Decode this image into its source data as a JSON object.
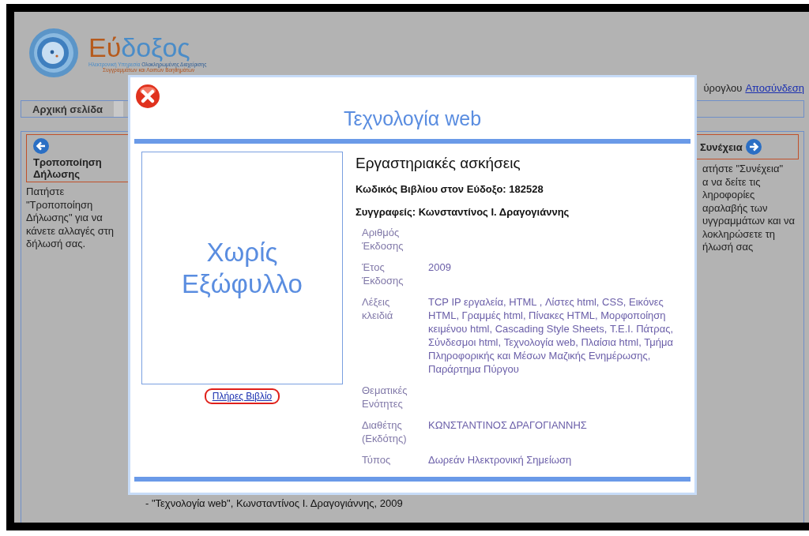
{
  "logo": {
    "title_first": "Εύ",
    "title_rest": "δοξος",
    "subtitle_first": "Ηλεκτρονική Υπηρεσία",
    "subtitle_rest": "Ολοκληρωμένης Διαχείρισης",
    "subtitle_line2": "Συγγραμμάτων και Λοιπών Βοηθημάτων"
  },
  "user_bar": {
    "name": "ύρογλου",
    "logout": "Αποσύνδεση"
  },
  "nav": {
    "tabs": [
      {
        "label": "Αρχική σελίδα",
        "selected": true
      }
    ]
  },
  "left_panel": {
    "button": "Τροποποίηση Δήλωσης",
    "text": "Πατήστε \"Τροποποίηση Δήλωσης\" για να κάνετε αλλαγές στη δήλωσή σας."
  },
  "right_panel": {
    "button": "Συνέχεια",
    "text_lines": [
      "ατήστε \"Συνέχεια\"",
      "α να δείτε τις",
      "ληροφορίες",
      "αραλαβής των",
      "υγγραμμάτων και να",
      "λοκληρώσετε τη",
      "ήλωσή σας"
    ]
  },
  "book_list": [
    "- \"Τεχνολογία web\", Κωνσταντίνος Ι. Δραγογιάννης, 2009"
  ],
  "dialog": {
    "title": "Τεχνολογία web",
    "cover_text": "Χωρίς Εξώφυλλο",
    "full_book_link": "Πλήρες Βιβλίο",
    "subtitle": "Εργαστηριακές ασκήσεις",
    "code_line": "Κωδικός Βιβλίου στον Εύδοξο: 182528",
    "authors_line": "Συγγραφείς: Κωνσταντίνος Ι. Δραγογιάννης",
    "details": [
      {
        "label": "Αριθμός Έκδοσης"
      },
      {
        "label": "Έτος Έκδοσης",
        "value": "2009"
      },
      {
        "label": "Λέξεις κλειδιά",
        "value": "TCP IP εργαλεία, HTML , Λίστες html, CSS, Εικόνες HTML, Γραμμές html, Πίνακες HTML, Μορφοποίηση κειμένου html, Cascading Style Sheets, Τ.Ε.Ι. Πάτρας, Σύνδεσμοι html, Τεχνολογία web, Πλαίσια html, Τμήμα Πληροφορικής και Μέσων Μαζικής Ενημέρωσης, Παράρτημα Πύργου"
      },
      {
        "label": "Θεματικές Ενότητες"
      },
      {
        "label": "Διαθέτης (Εκδότης)",
        "value": "ΚΩΝΣΤΑΝΤΙΝΟΣ ΔΡΑΓΟΓΙΑΝΝΗΣ"
      },
      {
        "label": "Τύπος",
        "value": "Δωρεάν Ηλεκτρονική Σημείωση"
      }
    ]
  }
}
